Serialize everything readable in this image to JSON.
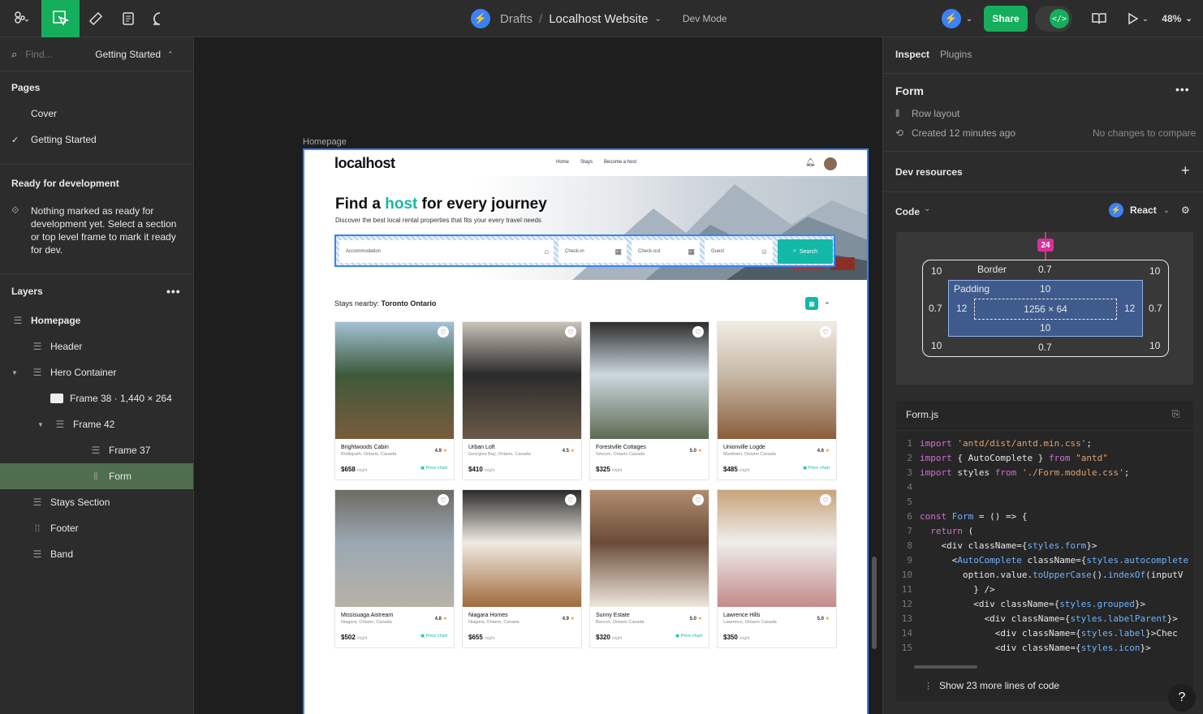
{
  "topbar": {
    "project": "Drafts",
    "file": "Localhost Website",
    "mode": "Dev Mode",
    "share": "Share",
    "zoom": "48%"
  },
  "left": {
    "find_placeholder": "Find...",
    "current_page": "Getting Started",
    "pages_heading": "Pages",
    "pages": [
      "Cover",
      "Getting Started"
    ],
    "ready_heading": "Ready for development",
    "ready_text": "Nothing marked as ready for development yet. Select a section or top level frame to mark it ready for dev.",
    "layers_heading": "Layers",
    "layers": [
      "Homepage",
      "Header",
      "Hero Container",
      "Frame 38 · 1,440 × 264",
      "Frame 42",
      "Frame 37",
      "Form",
      "Stays Section",
      "Footer",
      "Band"
    ]
  },
  "canvas": {
    "frame_label": "Homepage",
    "site": {
      "logo": "localhost",
      "nav": [
        "Home",
        "Stays",
        "Become a host"
      ],
      "hero_prefix": "Find a ",
      "hero_accent": "host",
      "hero_suffix": " for every journey",
      "hero_sub": "Discover the best local rental properties that fits your every travel needs",
      "fields": [
        "Accommodation",
        "Check-in",
        "Check-out",
        "Guest"
      ],
      "search": "Search",
      "stays_prefix": "Stays nearby: ",
      "stays_city": "Toronto Ontario",
      "price_chart": "Price chart",
      "per_night": "/night",
      "cards": [
        {
          "name": "Brightwoods Cabin",
          "loc": "Bridlepath, Ontario, Canada",
          "rate": "4.9",
          "price": "$658"
        },
        {
          "name": "Urban Loft",
          "loc": "Georgina Bay, Ontario, Canada",
          "rate": "4.5",
          "price": "$410"
        },
        {
          "name": "Forestville Cottages",
          "loc": "Simcoe, Ontario Canada",
          "rate": "5.0",
          "price": "$325"
        },
        {
          "name": "Unionville Logde",
          "loc": "Markham, Ontario Canada",
          "rate": "4.6",
          "price": "$485"
        },
        {
          "name": "Missisuaga Aistream",
          "loc": "Niagara, Ontario, Canada",
          "rate": "4.8",
          "price": "$502"
        },
        {
          "name": "Niagara Homes",
          "loc": "Niagara, Ontario, Canada",
          "rate": "4.9",
          "price": "$655"
        },
        {
          "name": "Sunny Estate",
          "loc": "Barcort, Ontario Canada",
          "rate": "5.0",
          "price": "$320"
        },
        {
          "name": "Lawrence Hills",
          "loc": "Lawrence, Ontario Canada",
          "rate": "5.0",
          "price": "$350"
        }
      ]
    }
  },
  "right": {
    "tabs": [
      "Inspect",
      "Plugins"
    ],
    "component": "Form",
    "layout": "Row layout",
    "created": "Created 12 minutes ago",
    "no_changes": "No changes to compare",
    "dev_resources": "Dev resources",
    "code": "Code",
    "framework": "React",
    "box": {
      "gap": "24",
      "border_label": "Border",
      "padding_label": "Padding",
      "margin": "10",
      "border": "0.7",
      "padding_v": "10",
      "padding_h": "12",
      "size": "1256 × 64"
    },
    "code_file": "Form.js",
    "show_more": "Show 23 more lines of code",
    "help": "?"
  },
  "colors": {
    "accent": "#14ae5c",
    "brand": "#14b8a6",
    "selection": "#3b82f6"
  }
}
